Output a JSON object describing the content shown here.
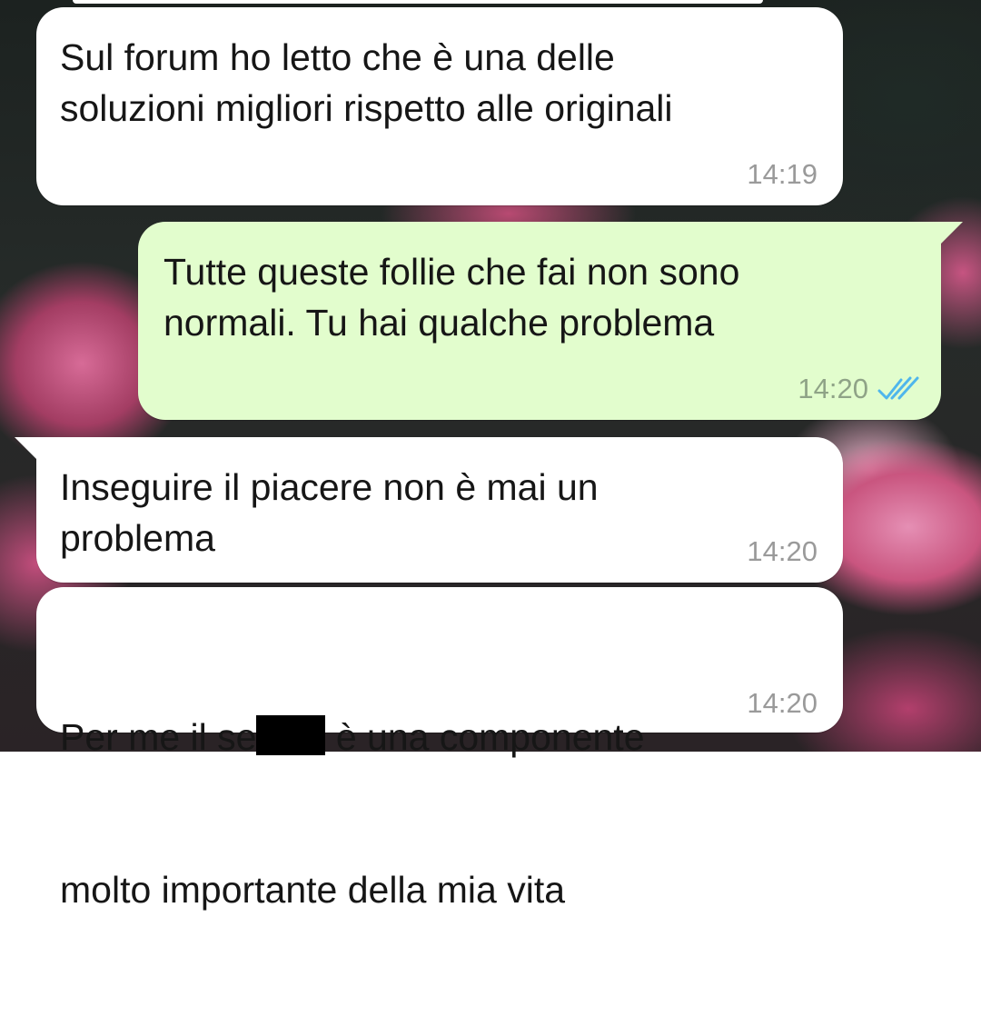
{
  "conversation": {
    "messages": [
      {
        "direction": "incoming",
        "text": "Sul forum ho letto che è una delle\nsoluzioni migliori rispetto alle originali",
        "time": "14:19"
      },
      {
        "direction": "outgoing",
        "text": "Tutte queste follie che fai non sono\nnormali. Tu hai qualche problema",
        "time": "14:20",
        "status": "read"
      },
      {
        "direction": "incoming",
        "text": "Inseguire il piacere non è mai un\nproblema",
        "time": "14:20"
      },
      {
        "direction": "incoming",
        "text_before_redaction": "Per me il se",
        "text_after_redaction": " è una componente",
        "text_second_line": "molto importante della mia vita",
        "time": "14:20",
        "redacted": true
      }
    ]
  },
  "icons": {
    "read_receipt": "double-check-icon"
  },
  "colors": {
    "incoming_bubble": "#ffffff",
    "outgoing_bubble": "#e2fdcd",
    "read_tick": "#4fb6ec",
    "timestamp": "#9a9a9a"
  }
}
